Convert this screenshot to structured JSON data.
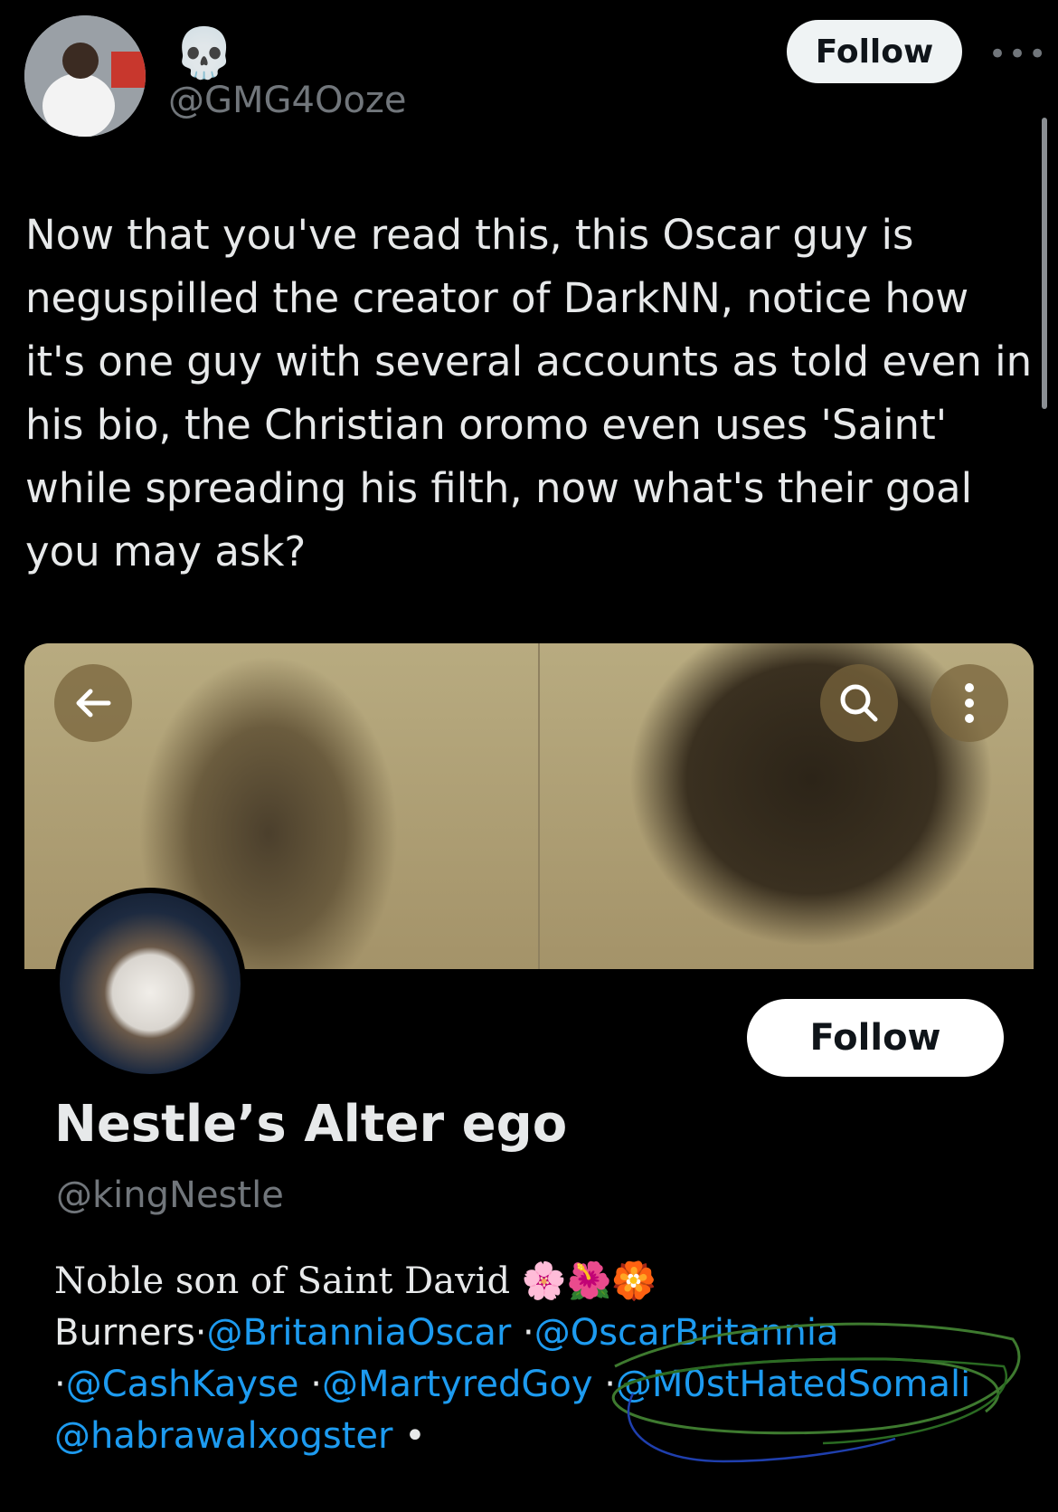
{
  "author": {
    "emoji": "💀",
    "handle": "@GMG4Ooze",
    "follow_label": "Follow",
    "more_icon": "•••"
  },
  "tweet": {
    "text": "Now that you've read this, this Oscar guy is neguspilled the creator of DarkNN, notice how it's one guy with several accounts as told even in his bio, the Christian oromo even uses 'Saint' while spreading his filth, now what's their goal you may ask?"
  },
  "profile_card": {
    "name": "Nestle’s Alter ego",
    "handle": "@kingNestle",
    "follow_label": "Follow",
    "bio_line1": "Noble son of Saint David",
    "bio_emojis": "🌸🌺🏵️",
    "burners_label": "Burners·",
    "mentions": [
      "@BritanniaOscar",
      "@OscarBritannia",
      "@CashKayse",
      "@MartyredGoy",
      "@M0stHatedSomali",
      "@habrawalxogster"
    ],
    "separators": [
      " ·",
      "·",
      " ·",
      " ·",
      " •"
    ]
  },
  "colors": {
    "background": "#000000",
    "text": "#e7e9ea",
    "muted": "#71767b",
    "link": "#1d9bf0"
  }
}
